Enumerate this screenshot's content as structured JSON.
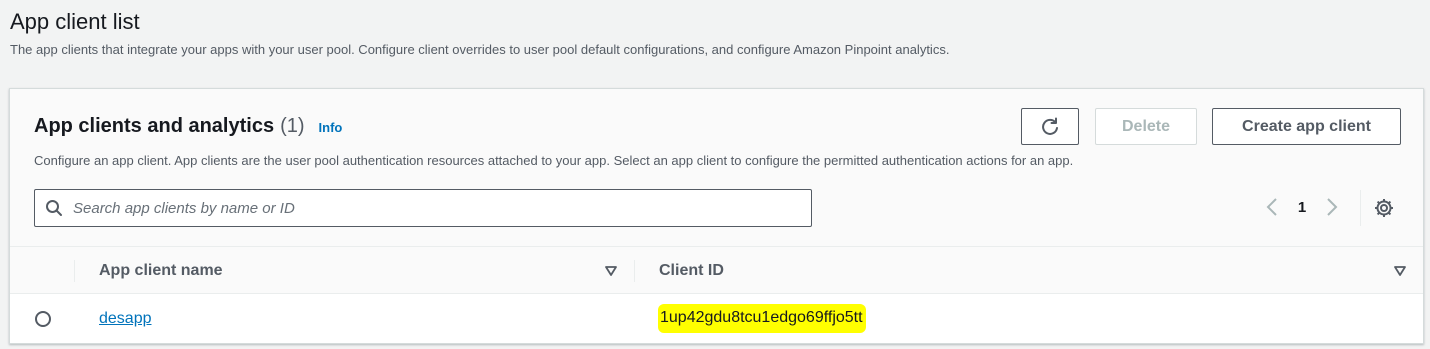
{
  "page": {
    "title": "App client list",
    "description": "The app clients that integrate your apps with your user pool. Configure client overrides to user pool default configurations, and configure Amazon Pinpoint analytics."
  },
  "panel": {
    "title": "App clients and analytics",
    "count": "(1)",
    "info_label": "Info",
    "description": "Configure an app client. App clients are the user pool authentication resources attached to your app. Select an app client to configure the permitted authentication actions for an app.",
    "refresh_icon": "refresh-icon",
    "delete_label": "Delete",
    "create_label": "Create app client",
    "search": {
      "placeholder": "Search app clients by name or ID",
      "value": ""
    },
    "pagination": {
      "current_page": "1"
    }
  },
  "table": {
    "columns": [
      "App client name",
      "Client ID"
    ],
    "rows": [
      {
        "name": "desapp",
        "client_id": "1up42gdu8tcu1edgo69ffjo5tt",
        "selected": false
      }
    ]
  },
  "colors": {
    "link": "#0073bb",
    "highlight": "#ffff00",
    "background": "#f2f3f3"
  }
}
